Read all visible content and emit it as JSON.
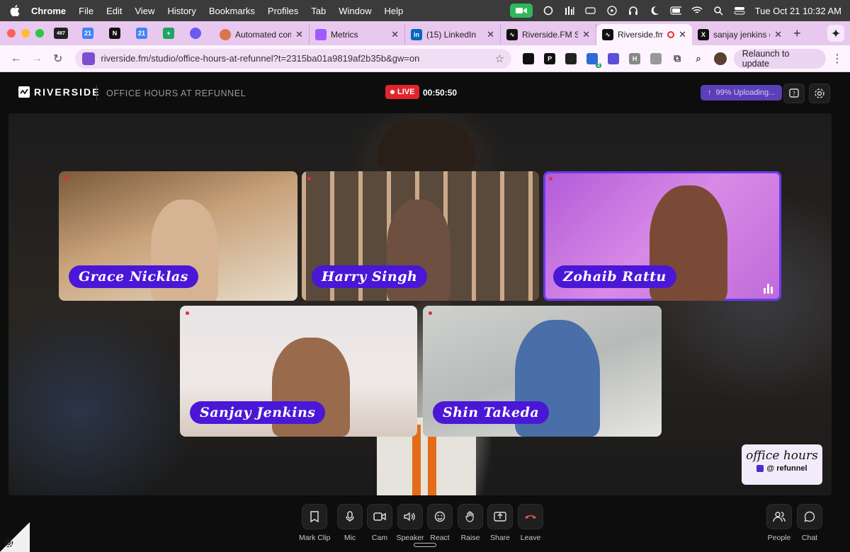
{
  "menubar": {
    "app": "Chrome",
    "items": [
      "File",
      "Edit",
      "View",
      "History",
      "Bookmarks",
      "Profiles",
      "Tab",
      "Window",
      "Help"
    ],
    "datetime": "Tue Oct 21  10:32 AM"
  },
  "tabs": {
    "pinned": [
      {
        "icon": "gmail-icon",
        "label": "497",
        "color": "#222222"
      },
      {
        "icon": "calendar-icon",
        "label": "21",
        "color": "#4285f4"
      },
      {
        "icon": "notion-icon",
        "label": "N",
        "color": "#111111"
      },
      {
        "icon": "calendar-icon",
        "label": "21",
        "color": "#4285f4"
      },
      {
        "icon": "sheets-icon",
        "label": "+",
        "color": "#1fa463"
      },
      {
        "icon": "linear-icon",
        "label": "",
        "color": "#6a5af0"
      }
    ],
    "items": [
      {
        "title": "Automated comp",
        "icon": "claude-icon",
        "color": "#d9764a"
      },
      {
        "title": "Metrics",
        "icon": "figma-icon",
        "color": "#a259ff"
      },
      {
        "title": "(15) LinkedIn",
        "icon": "linkedin-icon",
        "color": "#0a66c2"
      },
      {
        "title": "Riverside.FM Stu",
        "icon": "riverside-icon",
        "color": "#111111"
      },
      {
        "title": "Riverside.fm",
        "icon": "riverside-icon",
        "color": "#111111"
      },
      {
        "title": "sanjay jenkins o",
        "icon": "x-icon",
        "color": "#111111"
      }
    ],
    "active_index": 4
  },
  "toolbar": {
    "url": "riverside.fm/studio/office-hours-at-refunnel?t=2315ba01a9819af2b35b&gw=on",
    "relaunch_label": "Relaunch to update",
    "ext_badge": "2"
  },
  "studio": {
    "brand": "RIVERSIDE",
    "name": "OFFICE HOURS AT REFUNNEL",
    "live_label": "LIVE",
    "timer": "00:50:50",
    "upload_status": "99% Uploading..."
  },
  "participants": [
    {
      "name": "Grace Nicklas",
      "speaking": false
    },
    {
      "name": "Harry Singh",
      "speaking": false
    },
    {
      "name": "Zohaib Rattu",
      "speaking": true
    },
    {
      "name": "Sanjay Jenkins",
      "speaking": false
    },
    {
      "name": "Shin Takeda",
      "speaking": false
    }
  ],
  "badge": {
    "line1": "office hours",
    "line2": "@  refunnel"
  },
  "controls": [
    {
      "label": "Mark Clip",
      "icon": "bookmark-icon"
    },
    {
      "label": "Mic",
      "icon": "mic-icon"
    },
    {
      "label": "Cam",
      "icon": "camera-icon"
    },
    {
      "label": "Speaker",
      "icon": "speaker-icon"
    },
    {
      "label": "React",
      "icon": "smile-icon"
    },
    {
      "label": "Raise",
      "icon": "hand-icon"
    },
    {
      "label": "Share",
      "icon": "share-icon"
    },
    {
      "label": "Leave",
      "icon": "hangup-icon"
    }
  ],
  "side_controls": [
    {
      "label": "People",
      "icon": "people-icon"
    },
    {
      "label": "Chat",
      "icon": "chat-icon"
    }
  ],
  "colors": {
    "accent": "#4a17d6",
    "live": "#e0262a",
    "upload": "#5b3fb8"
  }
}
